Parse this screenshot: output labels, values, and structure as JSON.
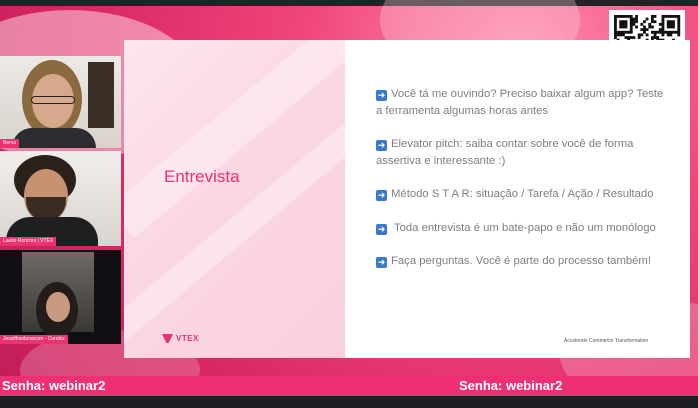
{
  "slide": {
    "title": "Entrevista",
    "bullets": [
      "Você tá me ouvindo? Preciso baixar algum app? Teste a ferramenta algumas horas antes",
      "Elevator pitch: saiba contar sobre você de forma assertiva e interessante :)",
      "Método S T A R: situação / Tarefa / Ação / Resultado",
      "Toda entrevista é um bate-papo e não um monólogo",
      "Faça perguntas. Você é parte do processo também!"
    ],
    "logo_text": "VTEX",
    "tagline": "Accelerate Commerce Transformation"
  },
  "participants": [
    {
      "name": "Bema"
    },
    {
      "name": "Laelio Ronconi | VTEX"
    },
    {
      "name": "Jessiffoedunacom - Corebiz"
    }
  ],
  "banner": {
    "left": "Senha: webinar2",
    "right": "Senha: webinar2"
  },
  "icons": {
    "bullet": "arrow-right-icon",
    "qr": "qr-code-icon"
  },
  "colors": {
    "brand": "#e8336e",
    "banner": "#ee2f73",
    "arrow": "#3a78c9"
  }
}
